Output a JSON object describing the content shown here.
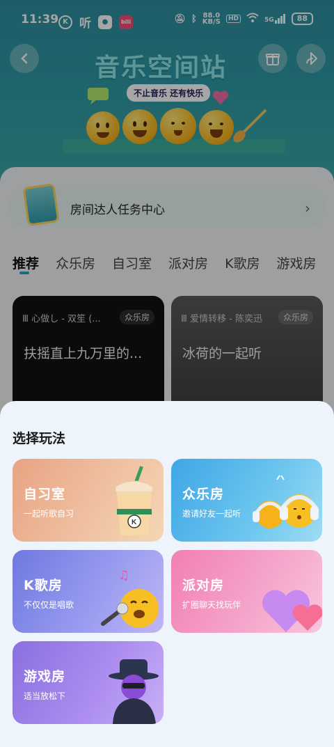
{
  "status_bar": {
    "time": "11:39",
    "app_k": "K",
    "app_ting": "听",
    "app_bili": "bili",
    "net_speed_value": "88.0",
    "net_speed_unit": "KB/S",
    "hd": "HD",
    "signal_label": "5G",
    "battery": "88"
  },
  "header": {
    "title": "音乐空间站",
    "subtitle": "不止音乐 还有快乐",
    "back_icon": "chevron-left-icon",
    "gift_icon": "gift-icon",
    "share_icon": "share-icon"
  },
  "task_banner": {
    "label": "房间达人任务中心",
    "arrow": "›"
  },
  "tabs": [
    {
      "label": "推荐",
      "active": true
    },
    {
      "label": "众乐房",
      "active": false
    },
    {
      "label": "自习室",
      "active": false
    },
    {
      "label": "派对房",
      "active": false
    },
    {
      "label": "K歌房",
      "active": false
    },
    {
      "label": "游戏房",
      "active": false
    }
  ],
  "rooms": [
    {
      "song": "心做し - 双笙 (...",
      "tag": "众乐房",
      "title": "扶摇直上九万里的..."
    },
    {
      "song": "爱情转移 - 陈奕迅",
      "tag": "众乐房",
      "title": "冰荷的一起听"
    }
  ],
  "sheet": {
    "title": "选择玩法",
    "modes": [
      {
        "name": "自习室",
        "desc": "一起听歌自习",
        "color": "#e8a383"
      },
      {
        "name": "众乐房",
        "desc": "邀请好友一起听",
        "color": "#3fa6e6"
      },
      {
        "name": "K歌房",
        "desc": "不仅仅是唱歌",
        "color": "#6f78e0"
      },
      {
        "name": "派对房",
        "desc": "扩圈聊天找玩伴",
        "color": "#f17fb3"
      },
      {
        "name": "游戏房",
        "desc": "适当放松下",
        "color": "#8a6fe0"
      }
    ]
  }
}
